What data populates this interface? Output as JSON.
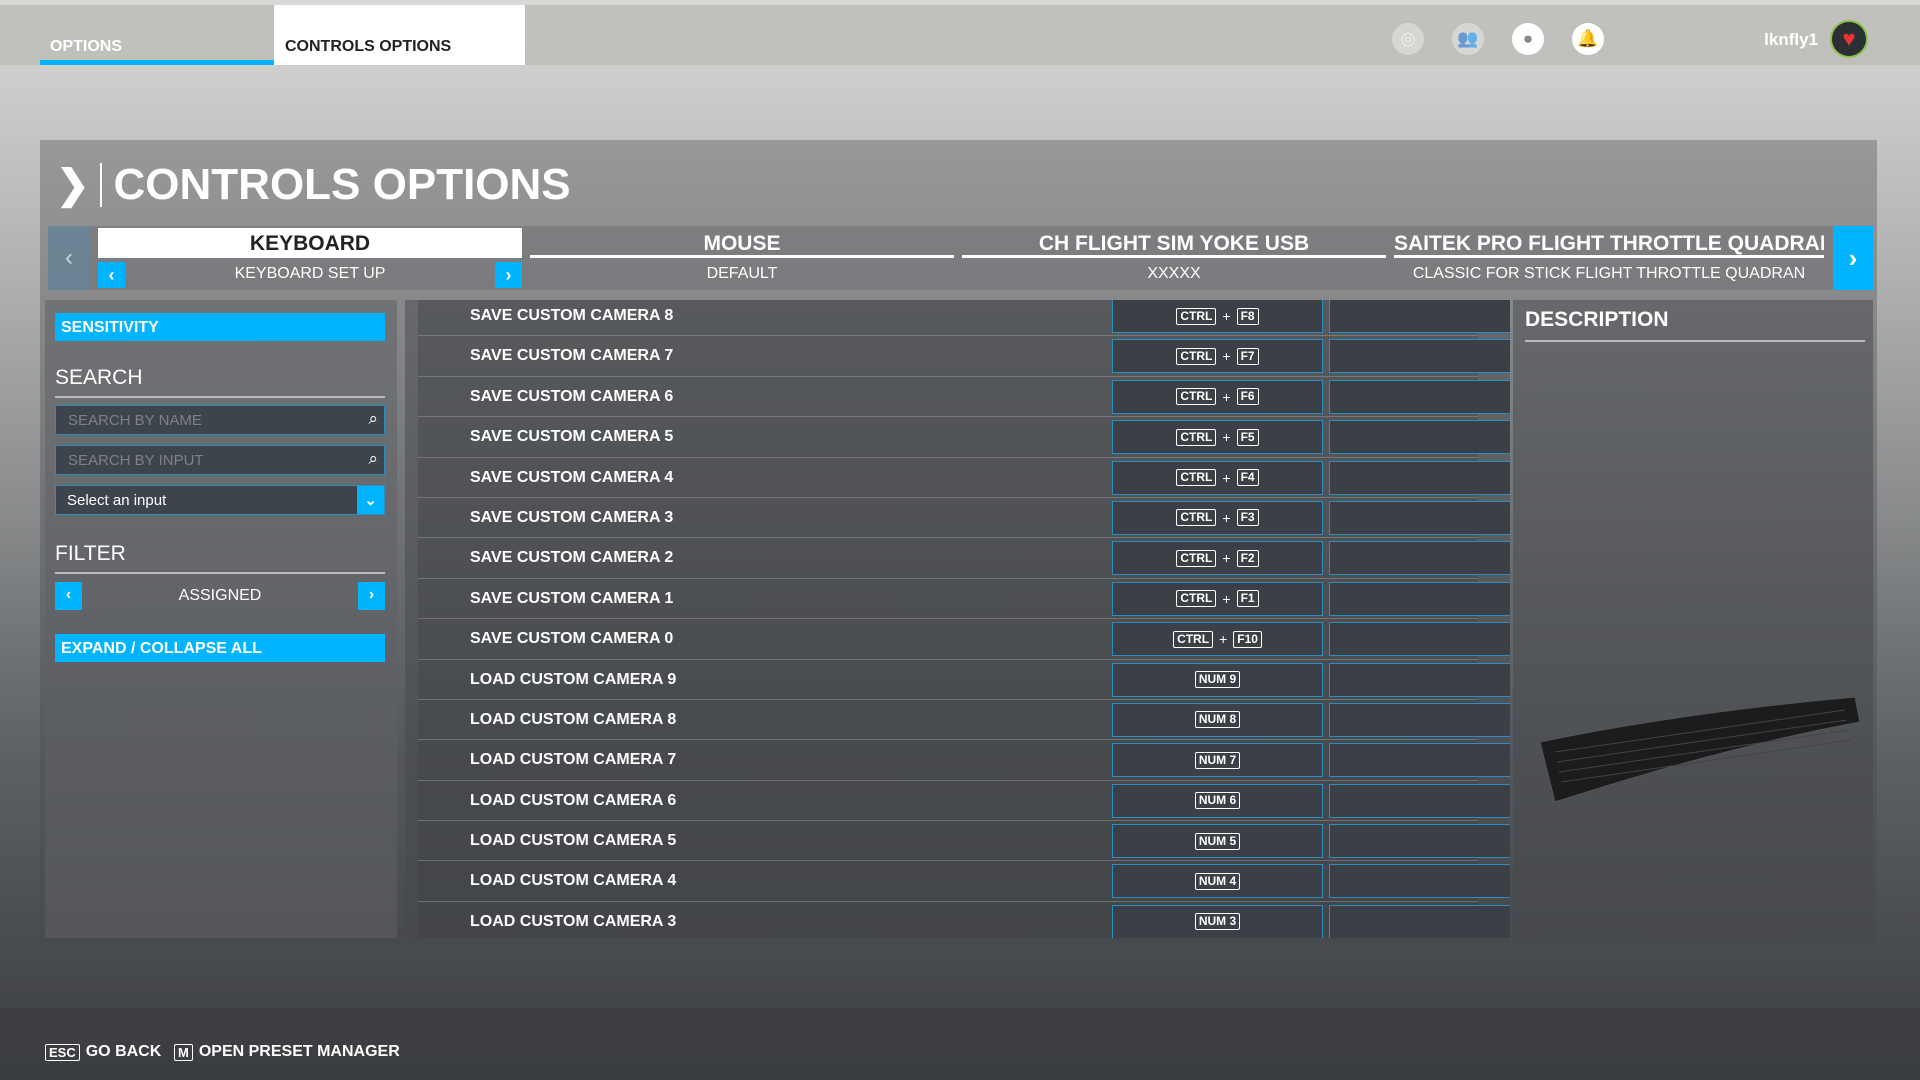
{
  "topbar": {
    "tabs": [
      "OPTIONS",
      "CONTROLS OPTIONS"
    ],
    "username": "lknfly1",
    "icons": [
      "activity-icon",
      "friends-icon",
      "profile-icon",
      "notifications-icon"
    ]
  },
  "page": {
    "title": "CONTROLS OPTIONS"
  },
  "devices": [
    {
      "name": "KEYBOARD",
      "preset": "KEYBOARD SET UP"
    },
    {
      "name": "MOUSE",
      "preset": "DEFAULT"
    },
    {
      "name": "CH FLIGHT SIM YOKE USB",
      "preset": "XXXXX"
    },
    {
      "name": "SAITEK PRO FLIGHT THROTTLE QUADRAN",
      "preset": "CLASSIC FOR STICK FLIGHT THROTTLE QUADRAN"
    }
  ],
  "left": {
    "sensitivity": "SENSITIVITY",
    "search_title": "SEARCH",
    "search_name_placeholder": "SEARCH BY NAME",
    "search_input_placeholder": "SEARCH BY INPUT",
    "select_input": "Select an input",
    "filter_title": "FILTER",
    "filter_value": "ASSIGNED",
    "expand": "EXPAND / COLLAPSE ALL"
  },
  "bindings": [
    {
      "label": "SAVE CUSTOM CAMERA 8",
      "keys": [
        "CTRL",
        "F8"
      ]
    },
    {
      "label": "SAVE CUSTOM CAMERA 7",
      "keys": [
        "CTRL",
        "F7"
      ]
    },
    {
      "label": "SAVE CUSTOM CAMERA 6",
      "keys": [
        "CTRL",
        "F6"
      ]
    },
    {
      "label": "SAVE CUSTOM CAMERA 5",
      "keys": [
        "CTRL",
        "F5"
      ]
    },
    {
      "label": "SAVE CUSTOM CAMERA 4",
      "keys": [
        "CTRL",
        "F4"
      ]
    },
    {
      "label": "SAVE CUSTOM CAMERA 3",
      "keys": [
        "CTRL",
        "F3"
      ]
    },
    {
      "label": "SAVE CUSTOM CAMERA 2",
      "keys": [
        "CTRL",
        "F2"
      ]
    },
    {
      "label": "SAVE CUSTOM CAMERA 1",
      "keys": [
        "CTRL",
        "F1"
      ]
    },
    {
      "label": "SAVE CUSTOM CAMERA 0",
      "keys": [
        "CTRL",
        "F10"
      ]
    },
    {
      "label": "LOAD CUSTOM CAMERA 9",
      "keys": [
        "NUM 9"
      ]
    },
    {
      "label": "LOAD CUSTOM CAMERA 8",
      "keys": [
        "NUM 8"
      ]
    },
    {
      "label": "LOAD CUSTOM CAMERA 7",
      "keys": [
        "NUM 7"
      ]
    },
    {
      "label": "LOAD CUSTOM CAMERA 6",
      "keys": [
        "NUM 6"
      ]
    },
    {
      "label": "LOAD CUSTOM CAMERA 5",
      "keys": [
        "NUM 5"
      ]
    },
    {
      "label": "LOAD CUSTOM CAMERA 4",
      "keys": [
        "NUM 4"
      ]
    },
    {
      "label": "LOAD CUSTOM CAMERA 3",
      "keys": [
        "NUM 3"
      ]
    }
  ],
  "key_join": "+",
  "description": {
    "title": "DESCRIPTION"
  },
  "footer": {
    "back_key": "ESC",
    "back_label": "GO BACK",
    "preset_key": "M",
    "preset_label": "OPEN PRESET MANAGER"
  },
  "colors": {
    "accent": "#00b4ff"
  }
}
